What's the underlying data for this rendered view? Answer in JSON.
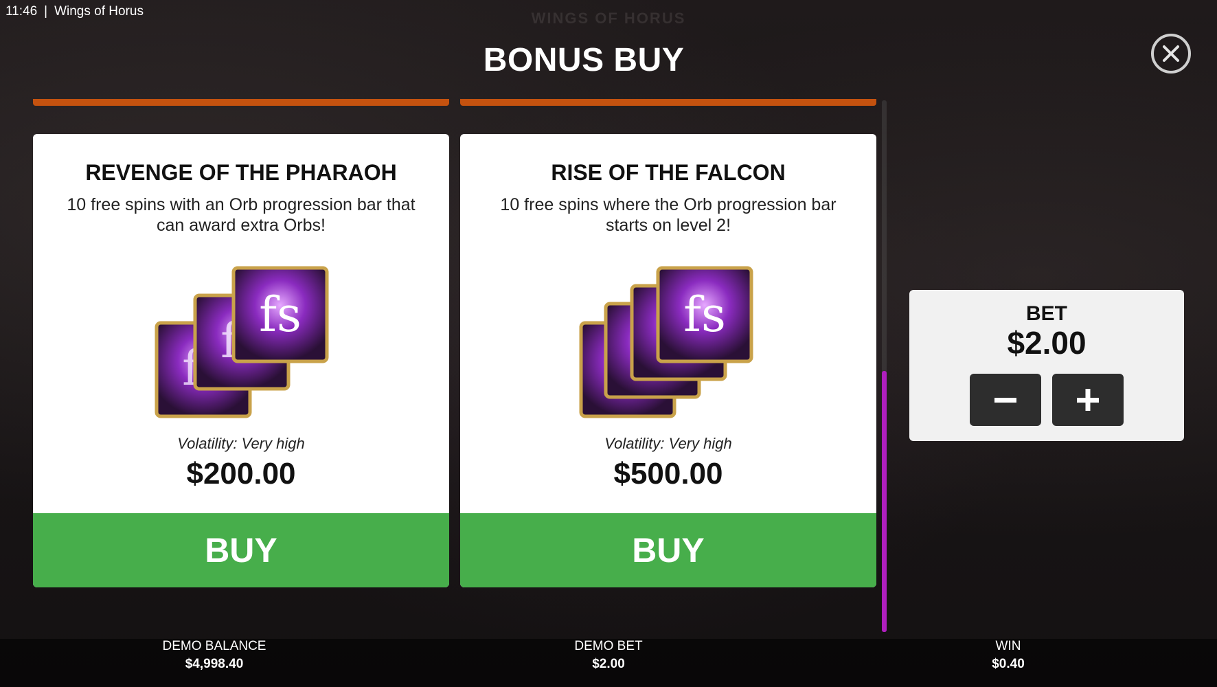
{
  "status_bar": {
    "time": "11:46",
    "separator": "|",
    "game_name": "Wings of Horus"
  },
  "background": {
    "logo_text": "WINGS OF HORUS"
  },
  "header": {
    "title": "BONUS BUY"
  },
  "cards": [
    {
      "title": "REVENGE OF THE PHARAOH",
      "description": "10 free spins with an Orb progression bar that can award extra Orbs!",
      "volatility": "Volatility: Very high",
      "price": "$200.00",
      "buy_label": "BUY",
      "image_icon": "free-spins-cards-3"
    },
    {
      "title": "RISE OF THE FALCON",
      "description": "10 free spins where the Orb progression bar starts on level 2!",
      "volatility": "Volatility: Very high",
      "price": "$500.00",
      "buy_label": "BUY",
      "image_icon": "free-spins-cards-4"
    }
  ],
  "bet_panel": {
    "label": "BET",
    "value": "$2.00"
  },
  "footer": {
    "balance_label": "DEMO BALANCE",
    "balance_value": "$4,998.40",
    "bet_label": "DEMO BET",
    "bet_value": "$2.00",
    "win_label": "WIN",
    "win_value": "$0.40"
  },
  "colors": {
    "buy_green": "#47ae4b",
    "accent_orange": "#c4520f",
    "scroll_purple": "#b01fbf",
    "card_purple": "#8a2bbf",
    "card_gold": "#c9a24a"
  }
}
